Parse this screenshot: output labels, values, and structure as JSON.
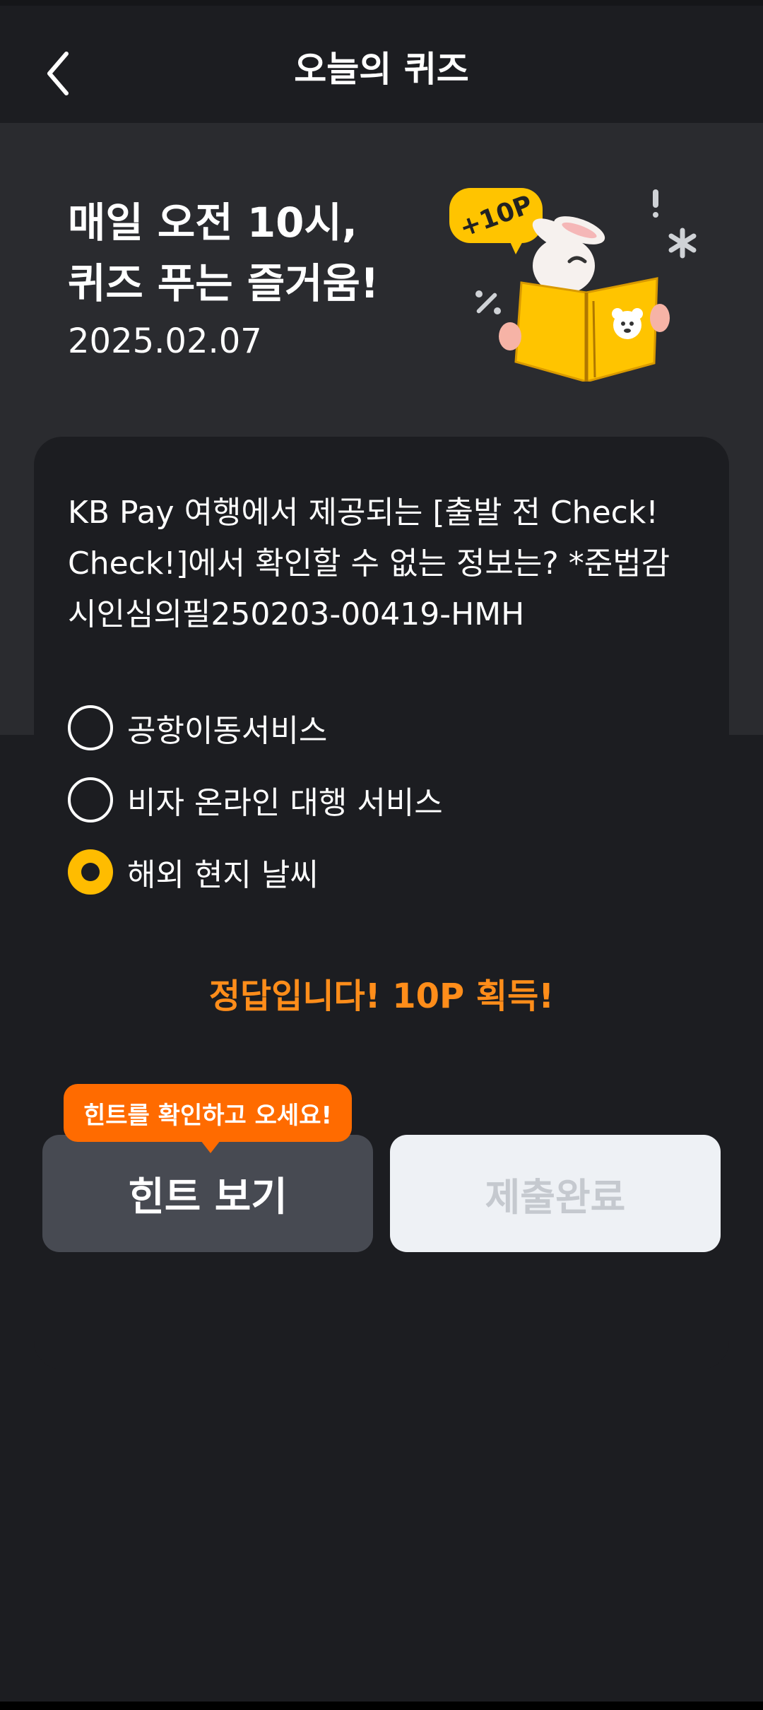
{
  "header": {
    "title": "오늘의 퀴즈"
  },
  "hero": {
    "title_line1": "매일 오전 10시,",
    "title_line2": "퀴즈 푸는 즐거움!",
    "date": "2025.02.07",
    "badge_text": "+10P"
  },
  "quiz": {
    "question_line1": "KB Pay 여행에서 제공되는 [출발 전 Check!",
    "question_line2": "Check!]에서 확인할 수 없는 정보는? *준법감",
    "question_line3": "시인심의필250203-00419-HMH",
    "options": [
      {
        "label": "공항이동서비스",
        "selected": false
      },
      {
        "label": "비자 온라인 대행 서비스",
        "selected": false
      },
      {
        "label": "해외 현지 날씨",
        "selected": true
      }
    ],
    "result_text": "정답입니다! 10P 획득!"
  },
  "actions": {
    "tooltip": "힌트를 확인하고 오세요!",
    "hint_label": "힌트 보기",
    "submit_label": "제출완료"
  },
  "colors": {
    "accent_yellow": "#ffbc00",
    "result_orange": "#ff8d1a",
    "tooltip_orange": "#ff6b00",
    "background": "#1c1d21"
  }
}
